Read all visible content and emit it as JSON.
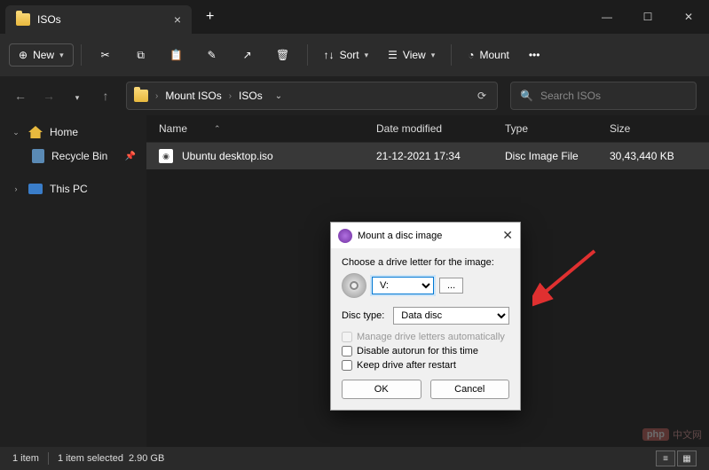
{
  "tab": {
    "title": "ISOs"
  },
  "toolbar": {
    "new": "New",
    "sort": "Sort",
    "view": "View",
    "mount": "Mount"
  },
  "breadcrumb": [
    "Mount ISOs",
    "ISOs"
  ],
  "search": {
    "placeholder": "Search ISOs"
  },
  "sidebar": {
    "home": "Home",
    "recycle": "Recycle Bin",
    "thispc": "This PC"
  },
  "columns": {
    "name": "Name",
    "date": "Date modified",
    "type": "Type",
    "size": "Size"
  },
  "files": [
    {
      "name": "Ubuntu desktop.iso",
      "date": "21-12-2021 17:34",
      "type": "Disc Image File",
      "size": "30,43,440 KB"
    }
  ],
  "status": {
    "count": "1 item",
    "selected": "1 item selected",
    "size": "2.90 GB"
  },
  "dialog": {
    "title": "Mount a disc image",
    "prompt": "Choose a drive letter for the image:",
    "driveletter": "V:",
    "more": "...",
    "disctype_label": "Disc type:",
    "disctype": "Data disc",
    "chk1": "Manage drive letters automatically",
    "chk2": "Disable autorun for this time",
    "chk3": "Keep drive after restart",
    "ok": "OK",
    "cancel": "Cancel"
  },
  "watermark": "中文网"
}
